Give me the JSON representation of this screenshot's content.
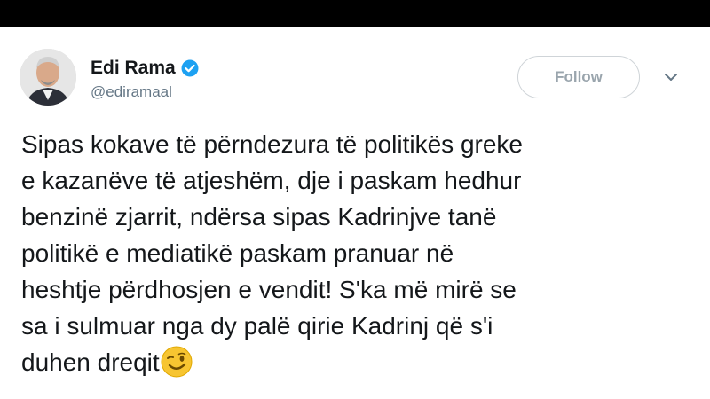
{
  "user": {
    "name": "Edi Rama",
    "handle": "@ediramaal",
    "verified_color": "#1da1f2"
  },
  "actions": {
    "follow_label": "Follow",
    "menu_icon": "chevron-down-icon"
  },
  "tweet": {
    "lines": [
      "Sipas kokave të përndezura të politikës greke",
      "e kazanëve të atjeshëm, dje i paskam hedhur",
      "benzinë zjarrit, ndërsa sipas Kadrinjve tanë",
      "politikë e mediatikë paskam pranuar në",
      "heshtje përdhosjen e vendit! S'ka më mirë se",
      "sa i sulmuar nga dy palë qirie Kadrinj që s'i",
      "duhen dreqit"
    ],
    "emoji": "winking-face-icon"
  },
  "colors": {
    "background": "#000000",
    "card": "#ffffff",
    "text": "#14171a",
    "muted": "#657786",
    "follow_border": "#cfd4d8",
    "emoji": "#f7c531"
  }
}
